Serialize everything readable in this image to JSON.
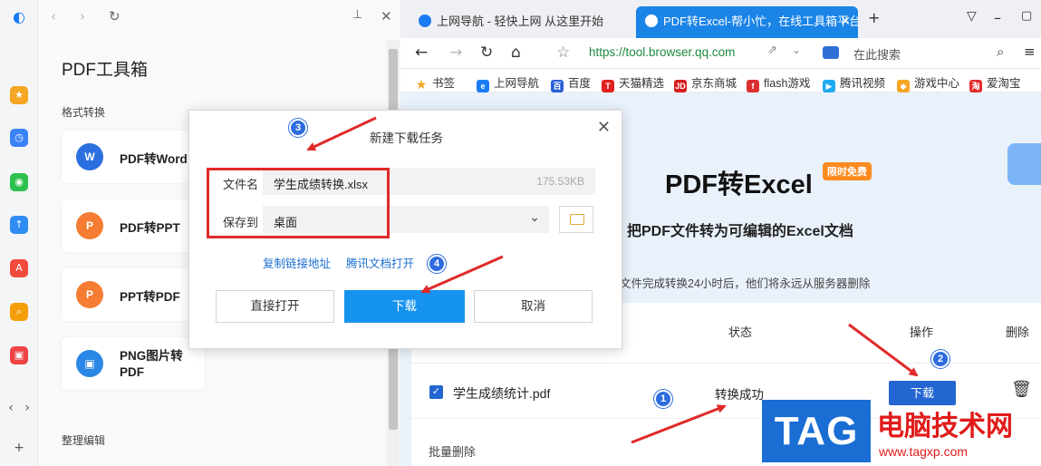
{
  "rail": {
    "items": [
      "qq-browser-logo",
      "favorites-icon",
      "history-icon",
      "wechat-icon",
      "cloud-icon",
      "pdf-icon",
      "search-icon",
      "ocr-icon"
    ],
    "colors": {
      "accent": "#1a7cf5",
      "star": "#f5a623",
      "history": "#3b82f6",
      "wechat": "#2ec04f",
      "cloud": "#2f8cf3",
      "pdf": "#f04b3c",
      "search": "#f59e0b",
      "ocr": "#ef4444"
    }
  },
  "panel": {
    "title": "PDF工具箱",
    "section_format": "格式转换",
    "section_organize": "整理编辑",
    "tools": [
      {
        "label": "PDF转Word",
        "icon_text": "W",
        "color": "#2b6fe0"
      },
      {
        "label": "PDF转PPT",
        "icon_text": "P",
        "color": "#f57c33"
      },
      {
        "label": "PPT转PDF",
        "icon_text": "P",
        "color": "#f57c33"
      },
      {
        "label": "PNG图片转PDF",
        "icon_text": "▣",
        "color": "#2b87e5"
      }
    ]
  },
  "tabs": [
    {
      "label": "上网导航 - 轻快上网 从这里开始",
      "active": false
    },
    {
      "label": "PDF转Excel-帮小忙，在线工具箱平台",
      "active": true
    }
  ],
  "toolbar": {
    "url": "https://tool.browser.qq.com",
    "search_placeholder": "在此搜索"
  },
  "bookmarks": [
    {
      "label": "书签",
      "color": "#f5a623",
      "mark": "★"
    },
    {
      "label": "上网导航",
      "color": "#1a7cf5",
      "mark": "e"
    },
    {
      "label": "百度",
      "color": "#2a5fd8",
      "mark": "百"
    },
    {
      "label": "天猫精选",
      "color": "#e02020",
      "mark": "T"
    },
    {
      "label": "京东商城",
      "color": "#d81e1e",
      "mark": "JD"
    },
    {
      "label": "flash游戏",
      "color": "#d92f2f",
      "mark": "f"
    },
    {
      "label": "腾讯视频",
      "color": "#20a8f0",
      "mark": "▶"
    },
    {
      "label": "游戏中心",
      "color": "#f5a623",
      "mark": "◆"
    },
    {
      "label": "爱淘宝",
      "color": "#e42b2b",
      "mark": "淘"
    }
  ],
  "page": {
    "hero_title": "PDF转Excel",
    "free_badge": "限时免费",
    "hero_subtitle": "把PDF文件转为可编辑的Excel文档",
    "notice": "文件完成转换24小时后，他们将永远从服务器删除",
    "table": {
      "headers": {
        "status": "状态",
        "action": "操作",
        "delete": "删除"
      },
      "rows": [
        {
          "file_name": "学生成绩统计.pdf",
          "status": "转换成功",
          "action": "下载"
        }
      ],
      "batch_delete": "批量删除"
    }
  },
  "modal": {
    "title": "新建下载任务",
    "file_label": "文件名",
    "file_name": "学生成绩转换.xlsx",
    "file_size": "175.53KB",
    "save_label": "保存到",
    "save_location": "桌面",
    "copy_link": "复制链接地址",
    "tencent_docs": "腾讯文档打开",
    "open_direct": "直接打开",
    "download": "下载",
    "cancel": "取消",
    "colors": {
      "primary": "#1693ef",
      "link": "#1c6fd1"
    }
  },
  "annotations": {
    "badges": [
      "1",
      "2",
      "3",
      "4"
    ],
    "box_color": "#e02a2a"
  },
  "watermark": {
    "tag": "TAG",
    "site_name": "电脑技术网",
    "site_url": "www.tagxp.com"
  }
}
